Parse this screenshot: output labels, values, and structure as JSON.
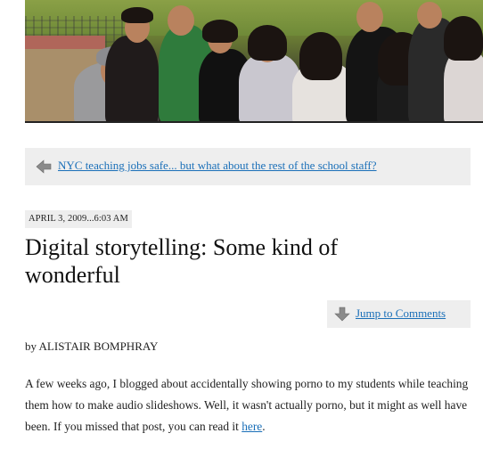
{
  "hero": {
    "image_name": "students-group-photo"
  },
  "nav": {
    "prev_label": "NYC teaching jobs safe... but what about the rest of the school staff?"
  },
  "post": {
    "date": "APRIL 3, 2009...6:03 AM",
    "title": "Digital storytelling: Some kind of wonderful",
    "jump_label": "Jump to Comments",
    "byline": "by ALISTAIR BOMPHRAY",
    "body_text": "A few weeks ago, I blogged about accidentally showing porno to my students while teaching them how to make audio slideshows. Well, it wasn't actually porno, but it might as well have been.  If you missed that post, you can read it ",
    "body_link": "here",
    "body_end": "."
  },
  "colors": {
    "link": "#1a6fb8",
    "box_bg": "#eeeeee",
    "text": "#222222"
  }
}
